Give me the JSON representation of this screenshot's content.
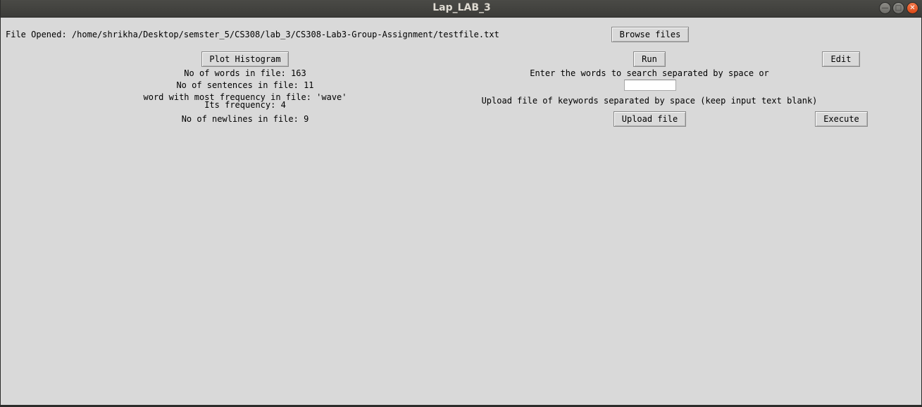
{
  "window": {
    "title": "Lap_LAB_3",
    "controls": {
      "minimize": "—",
      "maximize": "□",
      "close": "✕"
    }
  },
  "file": {
    "opened_label": "File Opened: /home/shrikha/Desktop/semster_5/CS308/lab_3/CS308-Lab3-Group-Assignment/testfile.txt",
    "browse_label": "Browse files"
  },
  "stats": {
    "plot_label": "Plot Histogram",
    "words": "No of words in file: 163",
    "sentences": "No of sentences in file: 11",
    "most_frequent": "word with most frequency in file: 'wave'",
    "frequency": "Its frequency: 4",
    "newlines": "No of newlines in file: 9"
  },
  "search": {
    "run_label": "Run",
    "edit_label": "Edit",
    "enter_prompt": "Enter the words to search separated by space or",
    "input_value": "",
    "upload_prompt": "Upload file of keywords separated by space (keep input text blank)",
    "upload_label": "Upload file",
    "execute_label": "Execute"
  }
}
